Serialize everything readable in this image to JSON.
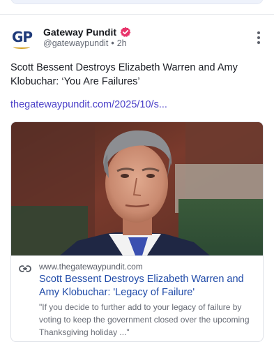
{
  "post": {
    "author": {
      "display_name": "Gateway Pundit",
      "avatar_initials": "GP",
      "handle": "@gatewaypundit",
      "separator": "•",
      "time": "2h",
      "verified_icon": "verified-badge-icon"
    },
    "text": "Scott Bessent Destroys Elizabeth Warren and Amy Klobuchar: ‘You Are Failures’",
    "link_text": "thegatewaypundit.com/2025/10/s...",
    "menu_icon": "more-vertical-icon"
  },
  "link_card": {
    "image_description_icon": "news-photo",
    "link_icon": "link-icon",
    "domain": "www.thegatewaypundit.com",
    "title": "Scott Bessent Destroys Elizabeth Warren and Amy Klobuchar: 'Legacy of Failure'",
    "description": "\"If you decide to further add to your legacy of failure by voting to keep the government closed over the upcoming Thanksgiving holiday ...\""
  },
  "colors": {
    "verified_badge": "#e8336a",
    "link": "#4a3fc8",
    "card_title": "#1f4aa8",
    "brand_blue": "#1f3a7a",
    "brand_gold": "#d4a020"
  }
}
